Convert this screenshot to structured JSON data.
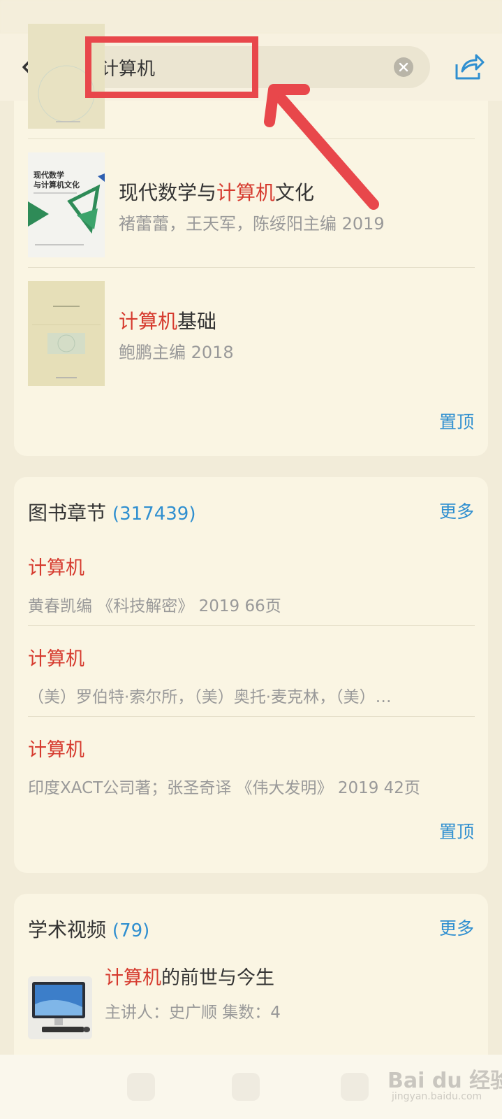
{
  "search": {
    "query": "计算机"
  },
  "books": {
    "items": [
      {
        "title_pre": "现代数学与",
        "title_hl": "计算机",
        "title_post": "文化",
        "meta": "褚蕾蕾，王天军，陈绥阳主编   2019",
        "cover_title": "现代数学\n与计算机文化"
      },
      {
        "title_pre": "",
        "title_hl": "计算机",
        "title_post": "基础",
        "meta": "鲍鹏主编   2018"
      }
    ],
    "pin_label": "置顶"
  },
  "chapters": {
    "title": "图书章节",
    "count": "(317439)",
    "more_label": "更多",
    "items": [
      {
        "title": "计算机",
        "meta": "黄春凯编 《科技解密》 2019 66页"
      },
      {
        "title": "计算机",
        "meta": "（美）罗伯特·索尔所，（美）奥托·麦克林，（美）…"
      },
      {
        "title": "计算机",
        "meta": "印度XACT公司著；张圣奇译 《伟大发明》 2019 42页"
      }
    ],
    "pin_label": "置顶"
  },
  "videos": {
    "title": "学术视频",
    "count": "(79)",
    "more_label": "更多",
    "items": [
      {
        "title_hl": "计算机",
        "title_post": "的前世与今生",
        "meta": "主讲人：史广顺   集数：4"
      }
    ]
  },
  "watermark": {
    "logo": "Bai du 经验",
    "sub": "jingyan.baidu.com"
  },
  "colors": {
    "highlight": "#d63b2f",
    "link": "#2f8fd0",
    "annotation": "#e8474b",
    "background": "#f2ecd9"
  }
}
